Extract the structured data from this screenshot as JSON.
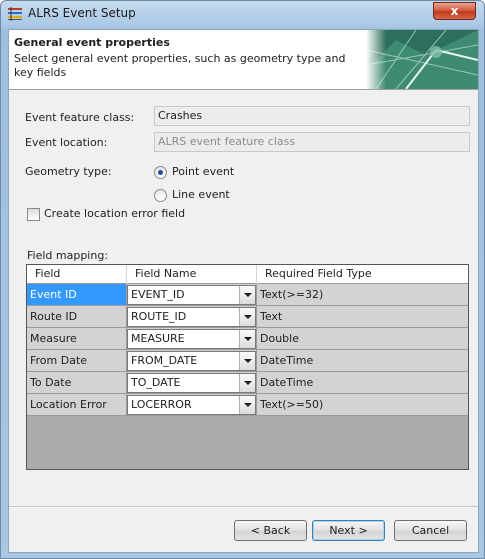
{
  "window": {
    "title": "ALRS Event Setup",
    "close_label": "x"
  },
  "header": {
    "title": "General event properties",
    "description": "Select general event properties, such as geometry type and key fields"
  },
  "form": {
    "event_feature_class": {
      "label": "Event feature class:",
      "value": "Crashes"
    },
    "event_location": {
      "label": "Event location:",
      "placeholder": "ALRS event feature class"
    },
    "geometry_type": {
      "label": "Geometry type:",
      "options": [
        {
          "label": "Point event",
          "selected": true
        },
        {
          "label": "Line event",
          "selected": false
        }
      ]
    },
    "create_location_error": {
      "label": "Create location error field",
      "checked": false
    }
  },
  "field_mapping": {
    "label": "Field mapping:",
    "columns": [
      "Field",
      "Field Name",
      "Required Field Type"
    ],
    "rows": [
      {
        "field": "Event ID",
        "field_name": "EVENT_ID",
        "type": "Text(>=32)"
      },
      {
        "field": "Route ID",
        "field_name": "ROUTE_ID",
        "type": "Text"
      },
      {
        "field": "Measure",
        "field_name": "MEASURE",
        "type": "Double"
      },
      {
        "field": "From Date",
        "field_name": "FROM_DATE",
        "type": "DateTime"
      },
      {
        "field": "To Date",
        "field_name": "TO_DATE",
        "type": "DateTime"
      },
      {
        "field": "Location Error",
        "field_name": "LOCERROR",
        "type": "Text(>=50)"
      }
    ]
  },
  "buttons": {
    "back": "< Back",
    "next": "Next >",
    "cancel": "Cancel"
  },
  "colors": {
    "selection": "#3399ff",
    "close_button": "#c23a1d"
  }
}
